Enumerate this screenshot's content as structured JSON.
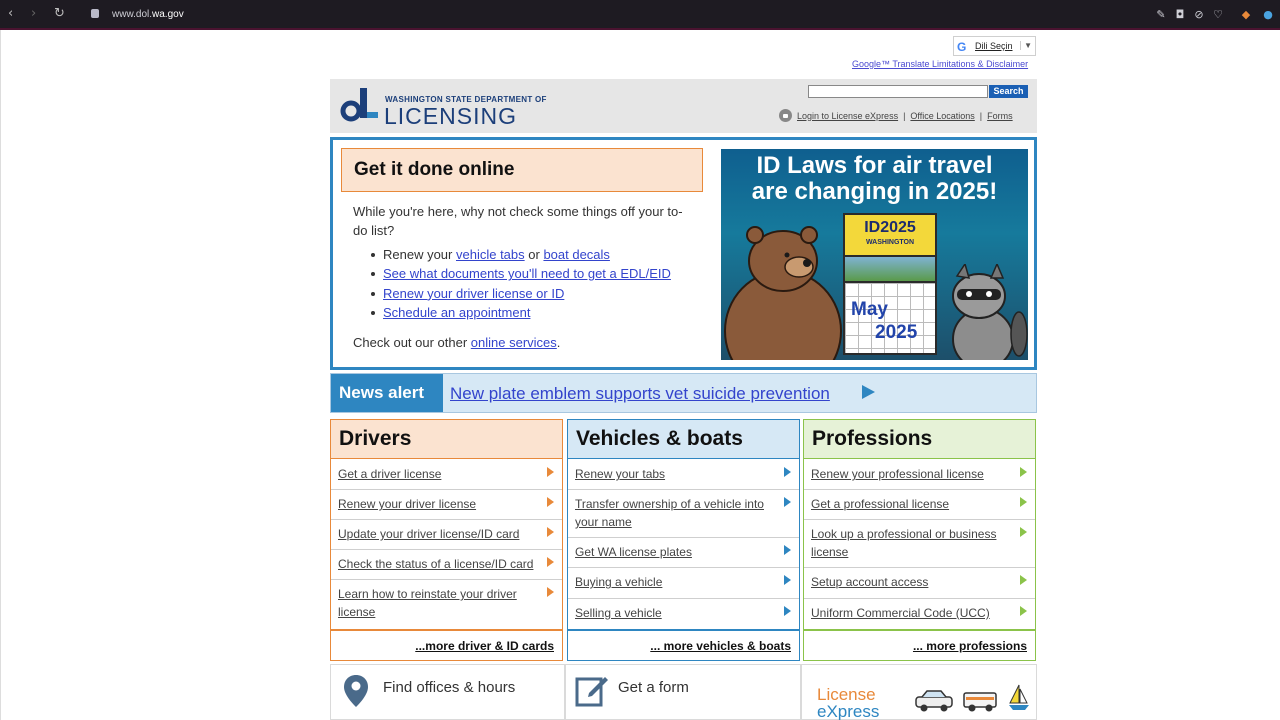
{
  "browser": {
    "url_prefix": "www.dol.",
    "url_domain": "wa.gov",
    "back": "‹",
    "forward": "›",
    "reload": "↻"
  },
  "translate": {
    "g": "G",
    "label": "Dili Seçin",
    "arrow": "▼",
    "disclaimer": "Google™ Translate Limitations & Disclaimer"
  },
  "header": {
    "logo_top": "WASHINGTON STATE DEPARTMENT OF",
    "logo_main": "LICENSING",
    "search_button": "Search",
    "search_placeholder": "",
    "links": {
      "login": "Login to License eXpress",
      "offices": "Office Locations",
      "forms": "Forms",
      "sep": "|"
    }
  },
  "hero": {
    "title": "Get it done online",
    "intro": "While you're here, why not check some things off your to-do list?",
    "item1_pre": "Renew your ",
    "item1_link1": "vehicle tabs",
    "item1_mid": " or ",
    "item1_link2": "boat decals",
    "item2": "See what documents you'll need to get a EDL/EID",
    "item3": "Renew your driver license or ID",
    "item4": "Schedule an appointment",
    "other_pre": "Check out our other ",
    "other_link": "online services",
    "other_post": "."
  },
  "banner": {
    "headline_1": "ID Laws for air travel",
    "headline_2": "are changing in 2025!",
    "cal_title": "ID2025",
    "cal_sub": "WASHINGTON",
    "month": "May",
    "year": "2025"
  },
  "news": {
    "label": "News alert",
    "link": "New plate emblem supports vet suicide prevention"
  },
  "columns": {
    "drivers": {
      "title": "Drivers",
      "items": [
        "Get a driver license",
        "Renew your driver license",
        "Update your driver license/ID card",
        "Check the status of a license/ID card",
        "Learn how to reinstate your driver license"
      ],
      "more": "...more driver & ID cards"
    },
    "vehicles": {
      "title": "Vehicles & boats",
      "items": [
        "Renew your tabs",
        "Transfer ownership of a vehicle into your name",
        "Get WA license plates",
        "Buying a vehicle",
        "Selling a vehicle"
      ],
      "more": "... more vehicles & boats"
    },
    "professions": {
      "title": "Professions",
      "items": [
        "Renew your professional license",
        "Get a professional license",
        "Look up a professional or business license",
        "Setup account access",
        "Uniform Commercial Code (UCC)"
      ],
      "more": "... more professions"
    }
  },
  "tiles": {
    "offices": "Find offices & hours",
    "form": "Get a form",
    "license_1": "License",
    "license_2": "eXpress"
  },
  "colors": {
    "drivers_accent": "#e8893a",
    "vehicles_accent": "#2e86c1",
    "professions_accent": "#8bc34a",
    "brand_navy": "#1c3f7a"
  }
}
